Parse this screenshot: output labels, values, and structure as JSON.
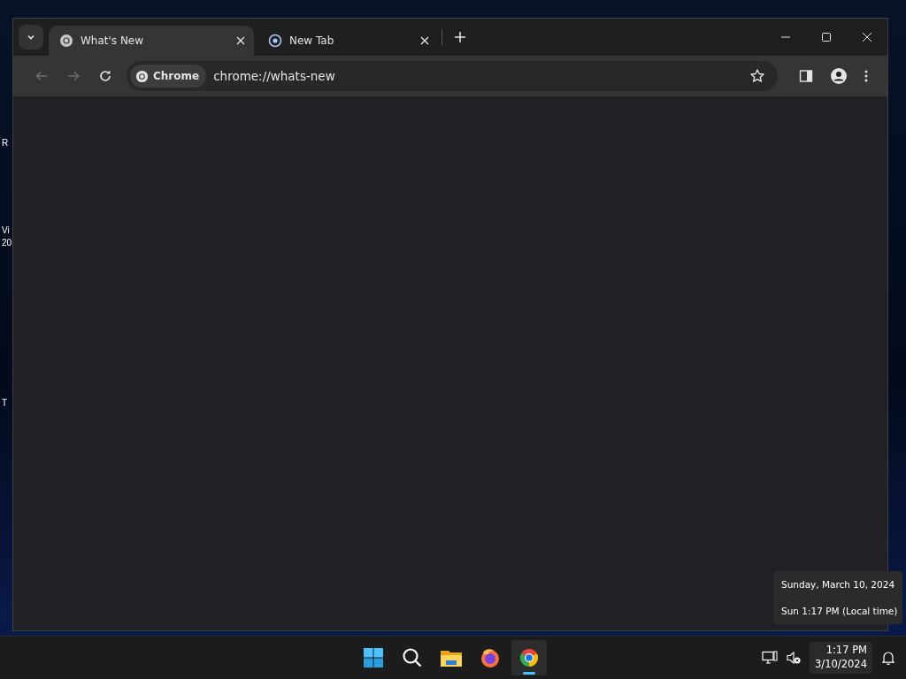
{
  "desktop_labels": [
    "R",
    "Vi",
    "20",
    "T"
  ],
  "window": {
    "tabs": [
      {
        "title": "What's New",
        "kind": "chrome",
        "selected": true
      },
      {
        "title": "New Tab",
        "kind": "newtab",
        "selected": false
      }
    ],
    "toolbar": {
      "back_disabled": true,
      "forward_disabled": true,
      "site_chip": "Chrome",
      "url": "chrome://whats-new"
    }
  },
  "tooltip": {
    "lines": [
      "Sunday, March 10, 2024",
      "Sun 1:17 PM (Local time)"
    ]
  },
  "taskbar": {
    "apps": [
      {
        "kind": "start",
        "selected": false
      },
      {
        "kind": "search",
        "selected": false
      },
      {
        "kind": "files",
        "selected": false
      },
      {
        "kind": "firefox",
        "selected": false
      },
      {
        "kind": "chrome",
        "selected": true
      }
    ],
    "clock": {
      "time": "1:17 PM",
      "date": "3/10/2024"
    }
  }
}
